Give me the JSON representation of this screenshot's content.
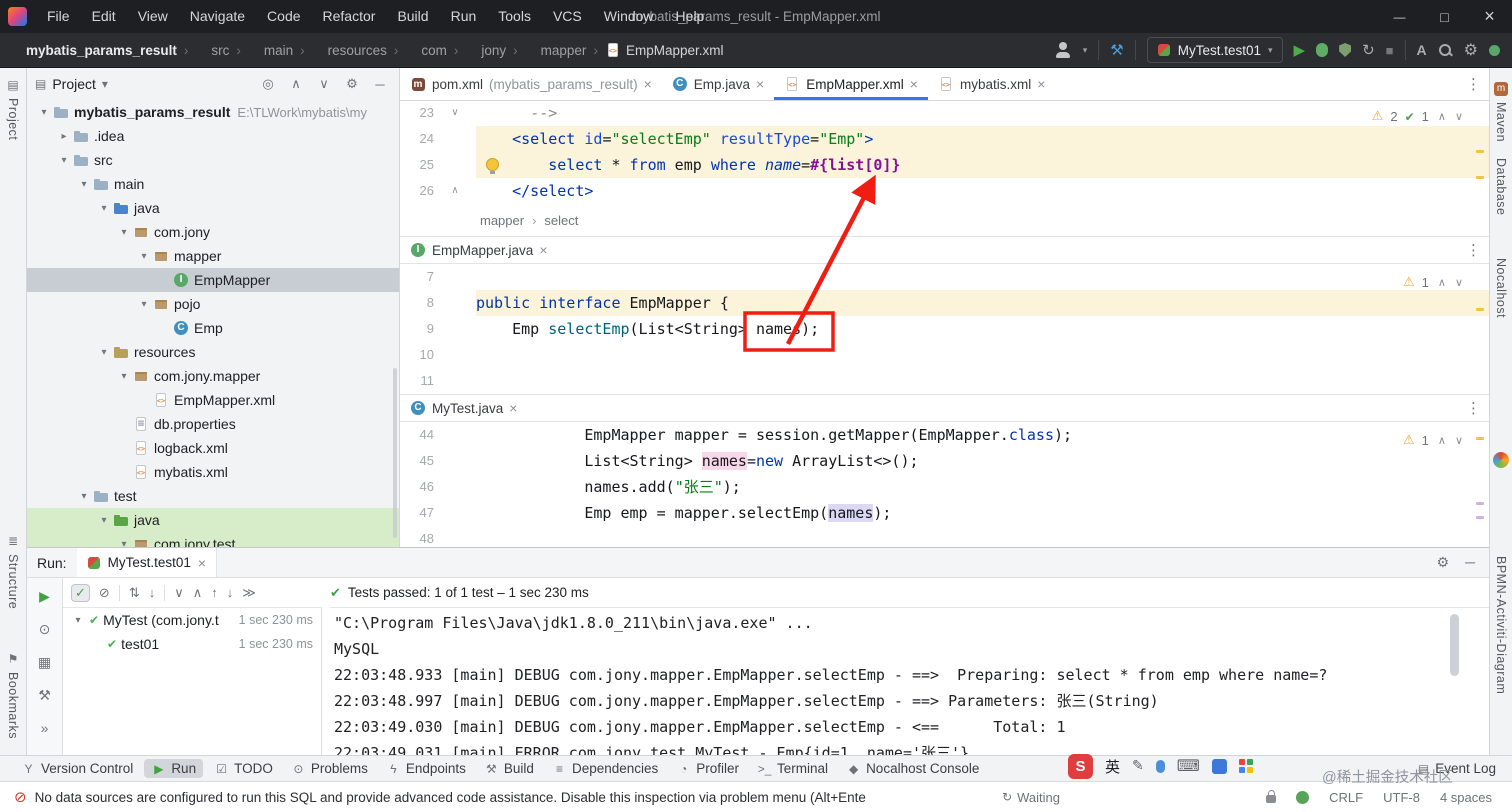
{
  "titlebar": {
    "menus": [
      "File",
      "Edit",
      "View",
      "Navigate",
      "Code",
      "Refactor",
      "Build",
      "Run",
      "Tools",
      "VCS",
      "Window",
      "Help"
    ],
    "title": "mybatis_params_result - EmpMapper.xml"
  },
  "toolbar": {
    "breadcrumbs": [
      {
        "label": "mybatis_params_result",
        "cls": "first"
      },
      {
        "label": "src"
      },
      {
        "label": "main"
      },
      {
        "label": "resources"
      },
      {
        "label": "com"
      },
      {
        "label": "jony"
      },
      {
        "label": "mapper"
      },
      {
        "label": "EmpMapper.xml",
        "icon": "xmlf",
        "cls": "last"
      }
    ],
    "run_config": "MyTest.test01"
  },
  "project": {
    "title": "Project",
    "tree": [
      {
        "indent": 0,
        "chev": "▾",
        "icon": "folder",
        "label": "mybatis_params_result",
        "sub": "E:\\TLWork\\mybatis\\my",
        "labelcls": "b"
      },
      {
        "indent": 1,
        "chev": "▸",
        "icon": "folder",
        "label": ".idea"
      },
      {
        "indent": 1,
        "chev": "▾",
        "icon": "folder",
        "label": "src"
      },
      {
        "indent": 2,
        "chev": "▾",
        "icon": "folder",
        "label": "main"
      },
      {
        "indent": 3,
        "chev": "▾",
        "icon": "folder blue",
        "label": "java"
      },
      {
        "indent": 4,
        "chev": "▾",
        "icon": "pkg",
        "label": "com.jony"
      },
      {
        "indent": 5,
        "chev": "▾",
        "icon": "pkg",
        "label": "mapper"
      },
      {
        "indent": 6,
        "chev": "",
        "icon": "itf",
        "label": "EmpMapper",
        "cls": "sel"
      },
      {
        "indent": 5,
        "chev": "▾",
        "icon": "pkg",
        "label": "pojo"
      },
      {
        "indent": 6,
        "chev": "",
        "icon": "cls",
        "label": "Emp"
      },
      {
        "indent": 3,
        "chev": "▾",
        "icon": "folder res",
        "label": "resources"
      },
      {
        "indent": 4,
        "chev": "▾",
        "icon": "pkg",
        "label": "com.jony.mapper"
      },
      {
        "indent": 5,
        "chev": "",
        "icon": "xmlf",
        "label": "EmpMapper.xml"
      },
      {
        "indent": 4,
        "chev": "",
        "icon": "propf",
        "label": "db.properties"
      },
      {
        "indent": 4,
        "chev": "",
        "icon": "xmlf",
        "label": "logback.xml"
      },
      {
        "indent": 4,
        "chev": "",
        "icon": "xmlf",
        "label": "mybatis.xml"
      },
      {
        "indent": 2,
        "chev": "▾",
        "icon": "folder",
        "label": "test"
      },
      {
        "indent": 3,
        "chev": "▾",
        "icon": "folder green",
        "label": "java",
        "cls": "vcs"
      },
      {
        "indent": 4,
        "chev": "▾",
        "icon": "pkg",
        "label": "com.jony.test",
        "cls": "vcs"
      }
    ]
  },
  "editors": {
    "tabs": [
      {
        "icon": "mvn",
        "label": "pom.xml",
        "suffix": " (mybatis_params_result)"
      },
      {
        "icon": "cls",
        "label": "Emp.java",
        "suffix": ""
      },
      {
        "icon": "xmlf",
        "label": "EmpMapper.xml",
        "suffix": "",
        "cls": "active"
      },
      {
        "icon": "xmlf",
        "label": "mybatis.xml",
        "suffix": ""
      }
    ],
    "xml": {
      "warn": "2",
      "ok": "1",
      "breadcrumb": [
        "mapper",
        "select"
      ],
      "lines": [
        {
          "num": "23",
          "fold": "∨",
          "segs": [
            {
              "t": "      ",
              "c": "pl"
            },
            {
              "t": "-->",
              "c": "cmt"
            }
          ]
        },
        {
          "num": "24",
          "cls": "cream",
          "segs": [
            {
              "t": "    ",
              "c": "pl"
            },
            {
              "t": "<select ",
              "c": "tag"
            },
            {
              "t": "id",
              "c": "attr"
            },
            {
              "t": "=",
              "c": "pl"
            },
            {
              "t": "\"selectEmp\"",
              "c": "str"
            },
            {
              "t": " ",
              "c": "pl"
            },
            {
              "t": "resultType",
              "c": "attr"
            },
            {
              "t": "=",
              "c": "pl"
            },
            {
              "t": "\"Emp\"",
              "c": "str"
            },
            {
              "t": ">",
              "c": "tag"
            }
          ]
        },
        {
          "num": "25",
          "cls": "cream",
          "segs": [
            {
              "t": "        ",
              "c": "pl"
            },
            {
              "t": "select",
              "c": "kw"
            },
            {
              "t": " * ",
              "c": "pl"
            },
            {
              "t": "from",
              "c": "kw"
            },
            {
              "t": " emp ",
              "c": "pl"
            },
            {
              "t": "where",
              "c": "kw"
            },
            {
              "t": " ",
              "c": "pl"
            },
            {
              "t": "name",
              "c": "sqlc"
            },
            {
              "t": "=",
              "c": "pl"
            },
            {
              "t": "#{list[0]}",
              "c": "param"
            }
          ]
        },
        {
          "num": "26",
          "fold": "∧",
          "segs": [
            {
              "t": "    ",
              "c": "pl"
            },
            {
              "t": "</select>",
              "c": "tag"
            }
          ]
        }
      ]
    },
    "java": {
      "tab": "EmpMapper.java",
      "warn": "1",
      "lines": [
        {
          "num": "7",
          "segs": []
        },
        {
          "num": "8",
          "cls": "cream",
          "segs": [
            {
              "t": "public ",
              "c": "kw"
            },
            {
              "t": "interface ",
              "c": "kw"
            },
            {
              "t": "EmpMapper {",
              "c": "pl"
            }
          ]
        },
        {
          "num": "9",
          "segs": [
            {
              "t": "    Emp ",
              "c": "pl"
            },
            {
              "t": "selectEmp",
              "c": "mth"
            },
            {
              "t": "(List<String> names);",
              "c": "pl"
            }
          ]
        },
        {
          "num": "10",
          "segs": []
        },
        {
          "num": "11",
          "segs": []
        }
      ]
    },
    "mytest": {
      "tab": "MyTest.java",
      "warn": "1",
      "lines": [
        {
          "num": "44",
          "segs": [
            {
              "t": "            EmpMapper mapper = session.",
              "c": "pl"
            },
            {
              "t": "getMapper",
              "c": "pl"
            },
            {
              "t": "(EmpMapper.",
              "c": "pl"
            },
            {
              "t": "class",
              "c": "kw"
            },
            {
              "t": ");",
              "c": "pl"
            }
          ]
        },
        {
          "num": "45",
          "segs": [
            {
              "t": "            List<String> ",
              "c": "pl"
            },
            {
              "t": "names",
              "c": "hlw"
            },
            {
              "t": "=",
              "c": "pl"
            },
            {
              "t": "new ",
              "c": "kw"
            },
            {
              "t": "ArrayList<>();",
              "c": "pl"
            }
          ]
        },
        {
          "num": "46",
          "segs": [
            {
              "t": "            names.add(",
              "c": "pl"
            },
            {
              "t": "\"张三\"",
              "c": "str"
            },
            {
              "t": ");",
              "c": "pl"
            }
          ]
        },
        {
          "num": "47",
          "segs": [
            {
              "t": "            Emp emp = mapper.selectEmp(",
              "c": "pl"
            },
            {
              "t": "names",
              "c": "hlr"
            },
            {
              "t": ");",
              "c": "pl"
            }
          ]
        },
        {
          "num": "48",
          "segs": []
        }
      ]
    }
  },
  "run": {
    "label": "Run:",
    "tab": "MyTest.test01",
    "status": "Tests passed: 1 of 1 test – 1 sec 230 ms",
    "tests": [
      {
        "indent": 0,
        "chev": "▾",
        "name": "MyTest (com.jony.t",
        "time": "1 sec 230 ms"
      },
      {
        "indent": 1,
        "chev": "",
        "name": "test01",
        "time": "1 sec 230 ms"
      }
    ],
    "console": [
      "\"C:\\Program Files\\Java\\jdk1.8.0_211\\bin\\java.exe\" ...",
      "MySQL",
      "22:03:48.933 [main] DEBUG com.jony.mapper.EmpMapper.selectEmp - ==>  Preparing: select * from emp where name=?",
      "22:03:48.997 [main] DEBUG com.jony.mapper.EmpMapper.selectEmp - ==> Parameters: 张三(String)",
      "22:03:49.030 [main] DEBUG com.jony.mapper.EmpMapper.selectEmp - <==      Total: 1",
      "22:03:49.031 [main] ERROR com.jony.test.MyTest - Emp{id=1, name='张三'}"
    ]
  },
  "statusbar": {
    "items": [
      {
        "name": "version-control",
        "glyph": "Y",
        "label": "Version Control"
      },
      {
        "name": "run",
        "glyph": "▶",
        "glyphcls": "green",
        "label": "Run",
        "cls": "active"
      },
      {
        "name": "todo",
        "glyph": "☑",
        "label": "TODO"
      },
      {
        "name": "problems",
        "glyph": "⊙",
        "label": "Problems"
      },
      {
        "name": "endpoints",
        "glyph": "ϟ",
        "label": "Endpoints"
      },
      {
        "name": "build",
        "glyph": "⚒",
        "label": "Build"
      },
      {
        "name": "dependencies",
        "glyph": "≡",
        "label": "Dependencies"
      },
      {
        "name": "profiler",
        "glyph": "◔",
        "label": "Profiler"
      },
      {
        "name": "terminal",
        "glyph": ">_",
        "label": "Terminal"
      },
      {
        "name": "nocalhost",
        "glyph": "◆",
        "label": "Nocalhost Console"
      }
    ],
    "event_log": "Event Log"
  },
  "bottombar": {
    "message": "No data sources are configured to run this SQL and provide advanced code assistance. Disable this inspection via problem menu (Alt+Ente",
    "waiting": "Waiting",
    "items": [
      "CRLF",
      "UTF-8",
      "4 spaces"
    ]
  },
  "side": {
    "left": [
      {
        "label": "Project",
        "glyph": "▤"
      },
      {
        "label": "Structure",
        "glyph": "≣"
      },
      {
        "label": "Bookmarks",
        "glyph": "⚑"
      }
    ],
    "right": [
      {
        "label": "Maven",
        "glyph": "m"
      },
      {
        "label": "Database",
        "glyph": ""
      },
      {
        "label": "Nocalhost",
        "glyph": ""
      },
      {
        "label": "BPMN-Activiti-Diagram",
        "glyph": ""
      }
    ]
  },
  "overlays": {
    "watermark": "@稀土掘金技术社区",
    "ime_app": "S",
    "ime_lang": "英"
  }
}
